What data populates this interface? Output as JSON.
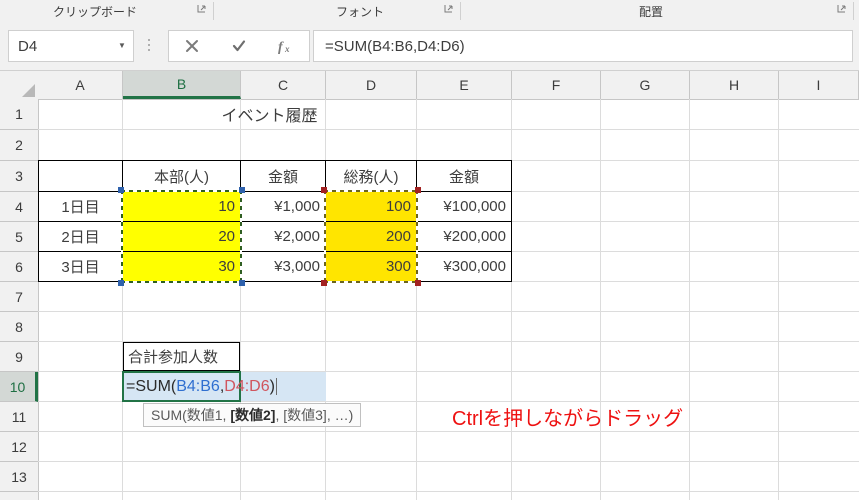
{
  "ribbon": {
    "groups": [
      {
        "label": "クリップボード",
        "launcher": "dialog-launcher-icon"
      },
      {
        "label": "フォント",
        "launcher": "dialog-launcher-icon"
      },
      {
        "label": "配置",
        "launcher": "dialog-launcher-icon"
      }
    ]
  },
  "formula_bar": {
    "name_box_value": "D4",
    "name_box_caret": "▼",
    "cancel_label": "✕",
    "enter_label": "✓",
    "fx_label": "fx",
    "formula_text": "=SUM(B4:B6,D4:D6)"
  },
  "grid": {
    "columns": [
      "A",
      "B",
      "C",
      "D",
      "E",
      "F",
      "G",
      "H",
      "I"
    ],
    "active_column": "B",
    "rows": [
      "1",
      "2",
      "3",
      "4",
      "5",
      "6",
      "7",
      "8",
      "9",
      "10",
      "11",
      "12",
      "13"
    ],
    "active_row": "10"
  },
  "sheet": {
    "title_cell": "イベント履歴",
    "table_headers": [
      "",
      "本部(人)",
      "金額",
      "総務(人)",
      "金額"
    ],
    "table_rows": [
      {
        "label": "1日目",
        "honbu": "10",
        "honbu_amount": "¥1,000",
        "soumu": "100",
        "soumu_amount": "¥100,000"
      },
      {
        "label": "2日目",
        "honbu": "20",
        "honbu_amount": "¥2,000",
        "soumu": "200",
        "soumu_amount": "¥200,000"
      },
      {
        "label": "3日目",
        "honbu": "30",
        "honbu_amount": "¥3,000",
        "soumu": "300",
        "soumu_amount": "¥300,000"
      }
    ],
    "total_label": "合計参加人数",
    "formula_cell": {
      "prefix": "=SUM(",
      "range1": "B4:B6",
      "separator": ",",
      "range2": "D4:D6",
      "suffix": ")"
    },
    "tooltip": {
      "prefix": "SUM(数値1, ",
      "bold": "[数値2]",
      "suffix": ", [数値3], …)"
    },
    "annotation": "Ctrlを押しながらドラッグ"
  },
  "colors": {
    "accent_green": "#217346",
    "fill_yellow": "#ffff00",
    "fill_gold": "#ffe500",
    "range1_token": "#2f6fd0",
    "range2_token": "#d0555e",
    "annotation_red": "#ee1111"
  }
}
